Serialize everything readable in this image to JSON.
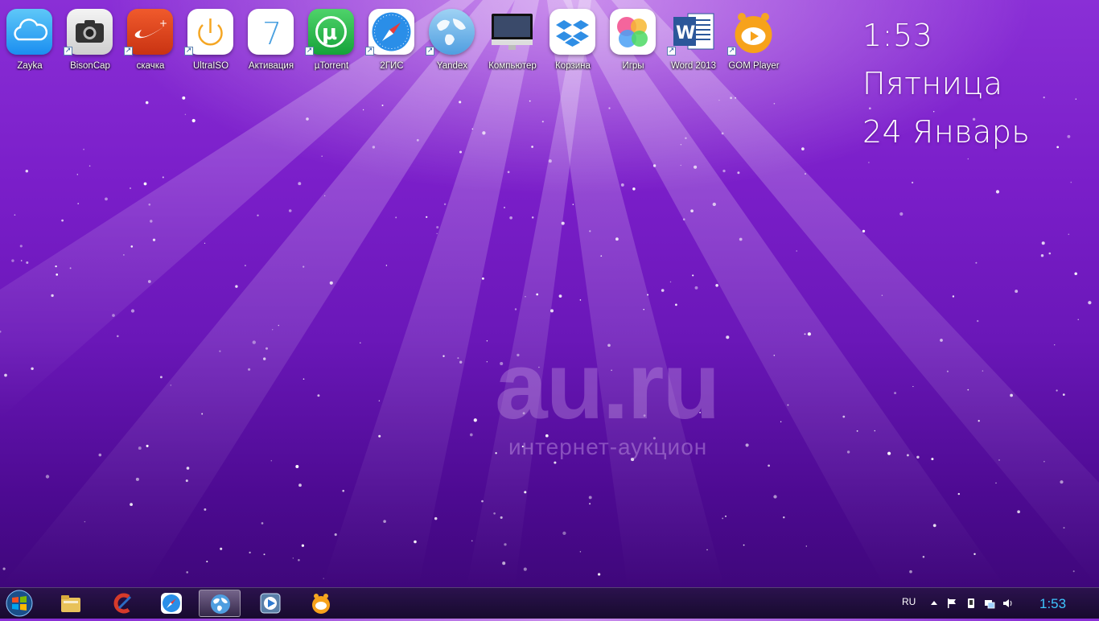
{
  "desktop": {
    "icons": [
      {
        "label": "Zayka",
        "icon": "icloud-icon",
        "shortcut": false
      },
      {
        "label": "BisonCap",
        "icon": "camera-icon",
        "shortcut": true
      },
      {
        "label": "скачка",
        "icon": "nike-icon",
        "shortcut": true
      },
      {
        "label": "UltraISO",
        "icon": "power-icon",
        "shortcut": true
      },
      {
        "label": "Активация",
        "icon": "ios7-icon",
        "shortcut": false
      },
      {
        "label": "µTorrent",
        "icon": "utorrent-icon",
        "shortcut": true
      },
      {
        "label": "2ГИС",
        "icon": "safari-compass-icon",
        "shortcut": true
      },
      {
        "label": "Yandex",
        "icon": "globe-map-icon",
        "shortcut": true
      },
      {
        "label": "Компьютер",
        "icon": "imac-icon",
        "shortcut": false
      },
      {
        "label": "Корзина",
        "icon": "dropbox-icon",
        "shortcut": false
      },
      {
        "label": "Игры",
        "icon": "game-center-icon",
        "shortcut": false
      },
      {
        "label": "Word 2013",
        "icon": "word-icon",
        "shortcut": true
      },
      {
        "label": "GOM Player",
        "icon": "gom-player-icon",
        "shortcut": true
      }
    ]
  },
  "clock_widget": {
    "time": "1:53",
    "weekday": "Пятница",
    "date": "24 Январь"
  },
  "watermark": {
    "logo": "au.ru",
    "subtitle": "интернет-аукцион"
  },
  "taskbar": {
    "start_icon": "windows-start-icon",
    "items": [
      {
        "icon": "file-explorer-icon",
        "active": false
      },
      {
        "icon": "ccleaner-icon",
        "active": false
      },
      {
        "icon": "safari-compass-icon",
        "active": false
      },
      {
        "icon": "globe-map-icon",
        "active": true
      },
      {
        "icon": "media-player-icon",
        "active": false
      },
      {
        "icon": "gom-player-icon",
        "active": false
      }
    ],
    "tray": {
      "language": "RU",
      "clock": "1:53"
    }
  },
  "colors": {
    "accent": "#3ec6ff",
    "background_top": "#8a2fd6",
    "background_bottom": "#3a0673"
  }
}
